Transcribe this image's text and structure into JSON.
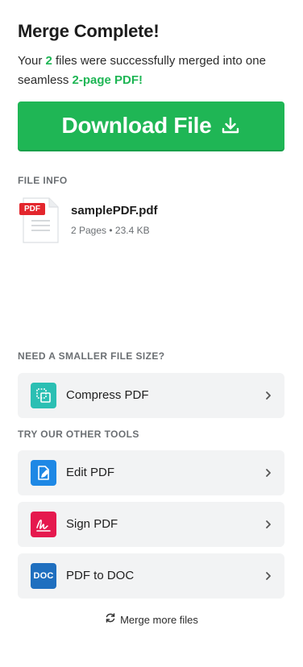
{
  "header": {
    "title": "Merge Complete!",
    "subtitle_prefix": "Your ",
    "file_count": "2",
    "subtitle_middle": " files were successfully merged into one seamless ",
    "page_info": "2-page PDF!"
  },
  "download": {
    "label": "Download File",
    "icon": "download-icon"
  },
  "file_info": {
    "section_label": "FILE INFO",
    "badge": "PDF",
    "name": "samplePDF.pdf",
    "meta": "2 Pages • 23.4 KB"
  },
  "smaller": {
    "section_label": "NEED A SMALLER FILE SIZE?",
    "tools": [
      {
        "label": "Compress PDF",
        "icon": "compress-icon",
        "color": "#2bbfb3"
      }
    ]
  },
  "other_tools": {
    "section_label": "TRY OUR OTHER TOOLS",
    "tools": [
      {
        "label": "Edit PDF",
        "icon": "edit-pdf-icon",
        "color": "#1e88e5"
      },
      {
        "label": "Sign PDF",
        "icon": "sign-icon",
        "color": "#e5194e"
      },
      {
        "label": "PDF to DOC",
        "icon": "doc-icon",
        "color": "#1f6fbf",
        "icon_text": "DOC"
      }
    ]
  },
  "merge_more": {
    "label": "Merge more files",
    "icon": "refresh-icon"
  },
  "colors": {
    "accent": "#1fb655",
    "card_bg": "#f2f3f4",
    "muted": "#6b6f73"
  }
}
